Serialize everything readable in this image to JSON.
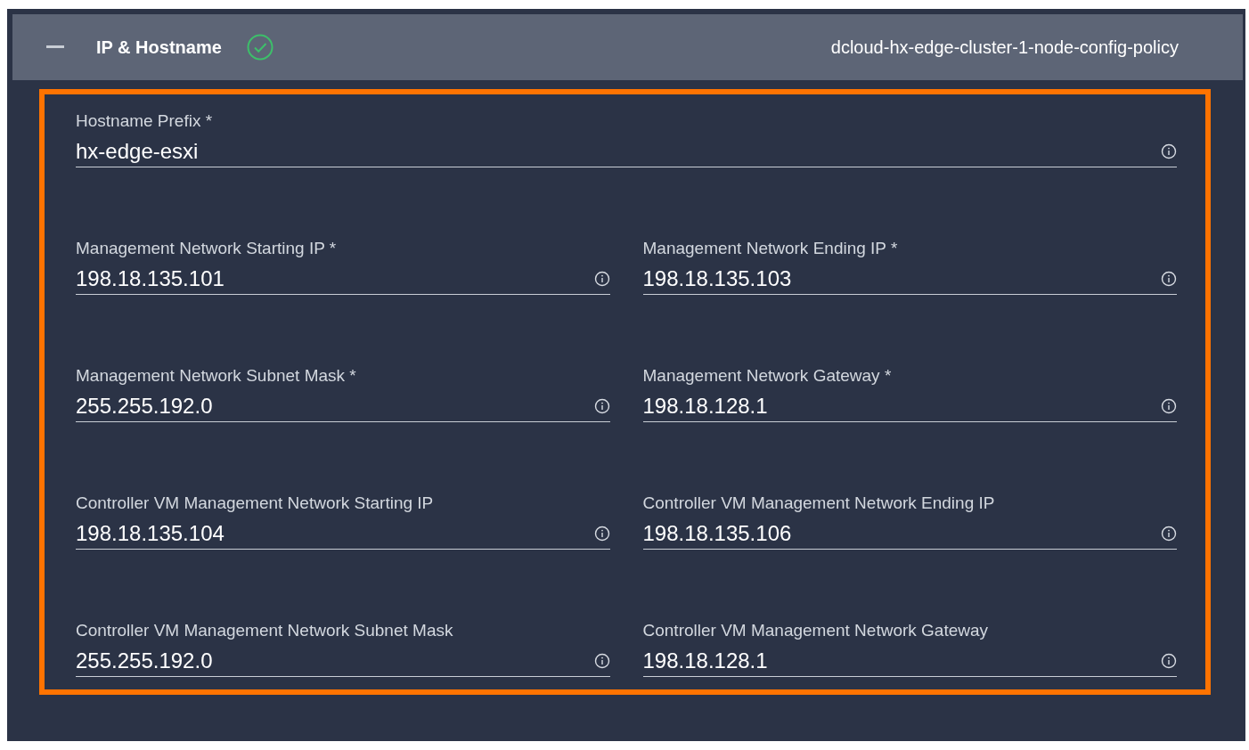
{
  "section": {
    "title": "IP & Hostname",
    "expanded": true,
    "valid": true,
    "policy_name": "dcloud-hx-edge-cluster-1-node-config-policy"
  },
  "highlighted": true,
  "fields": [
    {
      "label": "Hostname Prefix *",
      "value": "hx-edge-esxi",
      "kind": "full"
    },
    {
      "label": "Management Network Starting IP *",
      "value": "198.18.135.101",
      "kind": "half"
    },
    {
      "label": "Management Network Ending IP *",
      "value": "198.18.135.103",
      "kind": "half"
    },
    {
      "label": "Management Network Subnet Mask *",
      "value": "255.255.192.0",
      "kind": "half"
    },
    {
      "label": "Management Network Gateway *",
      "value": "198.18.128.1",
      "kind": "half"
    },
    {
      "label": "Controller VM Management Network Starting IP",
      "value": "198.18.135.104",
      "kind": "half"
    },
    {
      "label": "Controller VM Management Network Ending IP",
      "value": "198.18.135.106",
      "kind": "half"
    },
    {
      "label": "Controller VM Management Network Subnet Mask",
      "value": "255.255.192.0",
      "kind": "half"
    },
    {
      "label": "Controller VM Management Network Gateway",
      "value": "198.18.128.1",
      "kind": "half"
    }
  ]
}
